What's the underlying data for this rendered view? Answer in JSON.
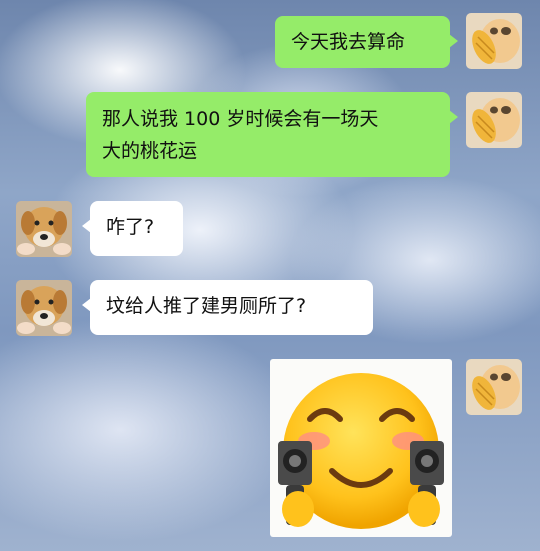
{
  "chat": {
    "messages": [
      {
        "sender": "me",
        "type": "text",
        "text": "今天我去算命",
        "avatar": "cat-avatar"
      },
      {
        "sender": "me",
        "type": "text",
        "line1": "那人说我 100 岁时候会有一场天",
        "line2": "大的桃花运",
        "avatar": "cat-avatar"
      },
      {
        "sender": "them",
        "type": "text",
        "text": "咋了?",
        "avatar": "dog-avatar"
      },
      {
        "sender": "them",
        "type": "text",
        "text": "坟给人推了建男厕所了?",
        "avatar": "dog-avatar"
      },
      {
        "sender": "me",
        "type": "sticker",
        "sticker": "smiling-emoji-with-guns",
        "avatar": "cat-avatar"
      }
    ]
  },
  "colors": {
    "my_bubble": "#95ec69",
    "their_bubble": "#ffffff"
  }
}
